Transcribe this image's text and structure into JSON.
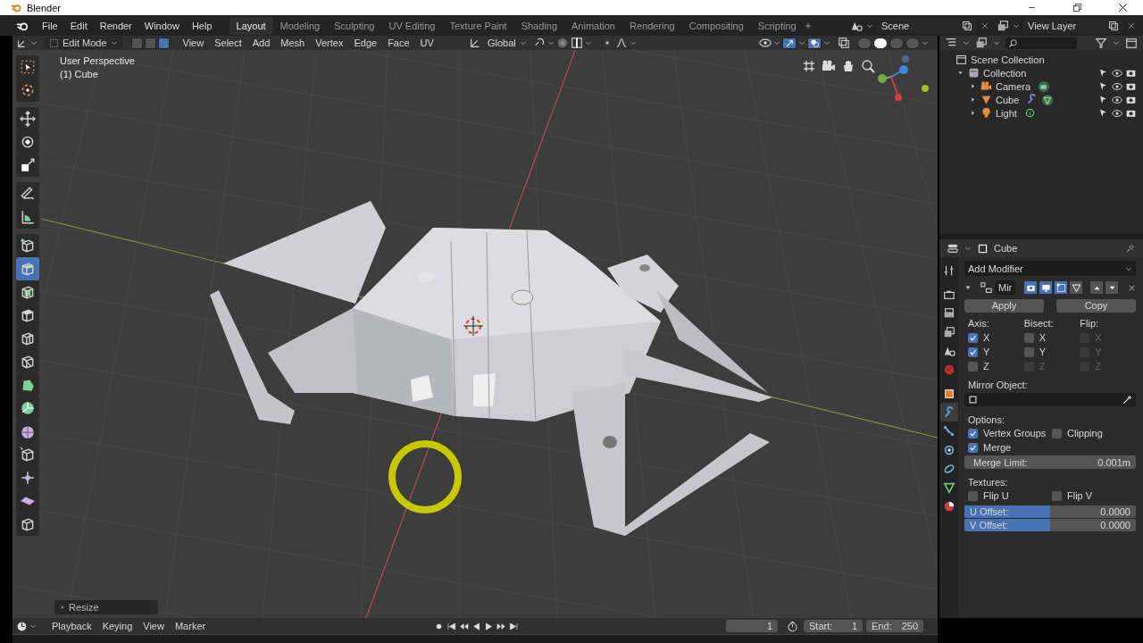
{
  "window": {
    "title": "Blender"
  },
  "menu": [
    "File",
    "Edit",
    "Render",
    "Window",
    "Help"
  ],
  "workspaces": [
    {
      "label": "Layout",
      "selected": true
    },
    {
      "label": "Modeling",
      "selected": false
    },
    {
      "label": "Sculpting",
      "selected": false
    },
    {
      "label": "UV Editing",
      "selected": false
    },
    {
      "label": "Texture Paint",
      "selected": false
    },
    {
      "label": "Shading",
      "selected": false
    },
    {
      "label": "Animation",
      "selected": false
    },
    {
      "label": "Rendering",
      "selected": false
    },
    {
      "label": "Compositing",
      "selected": false
    },
    {
      "label": "Scripting",
      "selected": false
    }
  ],
  "scene": "Scene",
  "view_layer": "View Layer",
  "viewport_header": {
    "mode": "Edit Mode",
    "select_modes": [
      {
        "selected": false
      },
      {
        "selected": false
      },
      {
        "selected": true
      }
    ],
    "menus": [
      "View",
      "Select",
      "Add",
      "Mesh",
      "Vertex",
      "Edge",
      "Face",
      "UV"
    ],
    "orientation": "Global",
    "shading": [
      {
        "selected": false
      },
      {
        "selected": true
      },
      {
        "selected": false
      },
      {
        "selected": false
      }
    ]
  },
  "viewport": {
    "info": [
      "User Perspective",
      "(1) Cube"
    ],
    "tools": [
      {
        "selected": false
      },
      {
        "selected": false
      },
      {
        "selected": false
      },
      {
        "selected": false
      },
      {
        "selected": false
      },
      {
        "selected": false
      },
      {
        "selected": false
      },
      {
        "selected": false
      },
      {
        "selected": true
      },
      {
        "selected": false
      },
      {
        "selected": false
      },
      {
        "selected": false
      },
      {
        "selected": false
      },
      {
        "selected": false
      },
      {
        "selected": false
      },
      {
        "selected": false
      },
      {
        "selected": false
      },
      {
        "selected": false
      },
      {
        "selected": false
      },
      {
        "selected": false
      }
    ],
    "last_operator": "Resize"
  },
  "outliner": {
    "items": [
      {
        "label": "Scene Collection",
        "kind": "scene",
        "children": [
          {
            "label": "Collection",
            "kind": "collection",
            "expanded": true,
            "children": [
              {
                "label": "Camera",
                "kind": "camera",
                "expanded": false
              },
              {
                "label": "Cube",
                "kind": "mesh",
                "expanded": false
              },
              {
                "label": "Light",
                "kind": "light",
                "expanded": false
              }
            ]
          }
        ]
      }
    ]
  },
  "properties": {
    "tabs": [
      {
        "selected": false
      },
      {
        "selected": false
      },
      {
        "selected": false
      },
      {
        "selected": false
      },
      {
        "selected": false
      },
      {
        "selected": false
      },
      {
        "selected": false
      },
      {
        "selected": true
      },
      {
        "selected": false
      },
      {
        "selected": false
      },
      {
        "selected": false
      },
      {
        "selected": false
      },
      {
        "selected": false
      }
    ],
    "object": "Cube",
    "add_modifier": "Add Modifier",
    "modifier": {
      "name": "Mir",
      "expanded": true,
      "toggles": [
        {
          "on": true
        },
        {
          "on": true
        },
        {
          "on": true
        },
        {
          "on": false
        }
      ],
      "actions": [
        "Apply",
        "Copy"
      ],
      "columns": [
        {
          "title": "Axis:",
          "items": [
            {
              "label": "X",
              "checked": true,
              "disabled": false
            },
            {
              "label": "Y",
              "checked": true,
              "disabled": false
            },
            {
              "label": "Z",
              "checked": false,
              "disabled": false
            }
          ]
        },
        {
          "title": "Bisect:",
          "items": [
            {
              "label": "X",
              "checked": false,
              "disabled": false
            },
            {
              "label": "Y",
              "checked": false,
              "disabled": false
            },
            {
              "label": "Z",
              "checked": false,
              "disabled": true
            }
          ]
        },
        {
          "title": "Flip:",
          "items": [
            {
              "label": "X",
              "checked": false,
              "disabled": true
            },
            {
              "label": "Y",
              "checked": false,
              "disabled": true
            },
            {
              "label": "Z",
              "checked": false,
              "disabled": true
            }
          ]
        }
      ],
      "mirror_object_label": "Mirror Object:",
      "options_label": "Options:",
      "options": [
        {
          "label": "Vertex Groups",
          "checked": true
        },
        {
          "label": "Clipping",
          "checked": false
        },
        {
          "label": "Merge",
          "checked": true
        }
      ],
      "merge_limit": {
        "label": "Merge Limit:",
        "value": "0.001m"
      },
      "textures_label": "Textures:",
      "textures": [
        {
          "label": "Flip U",
          "checked": false
        },
        {
          "label": "Flip V",
          "checked": false
        }
      ],
      "offsets": [
        {
          "label": "U Offset:",
          "value": "0.0000",
          "level": 0.5
        },
        {
          "label": "V Offset:",
          "value": "0.0000",
          "level": 0.5
        }
      ]
    }
  },
  "timeline": {
    "menus": [
      "Playback",
      "Keying",
      "View",
      "Marker"
    ],
    "frame": "1",
    "start_label": "Start:",
    "start": "1",
    "end_label": "End:",
    "end": "250"
  }
}
